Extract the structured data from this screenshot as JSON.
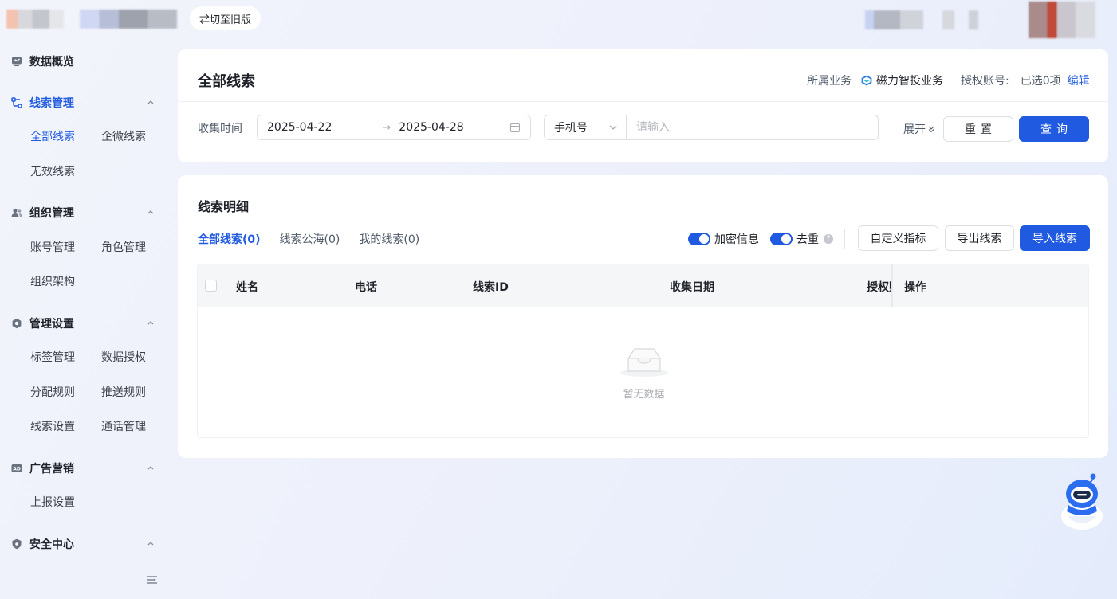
{
  "topbar": {
    "switch_old_label": "⇄切至旧版"
  },
  "sidebar": {
    "groups": [
      {
        "label": "数据概览",
        "icon": "dashboard-icon",
        "items": []
      },
      {
        "label": "线索管理",
        "icon": "flow-icon",
        "active": true,
        "items": [
          {
            "label": "全部线索",
            "active": true
          },
          {
            "label": "企微线索"
          },
          {
            "label": "无效线索"
          }
        ]
      },
      {
        "label": "组织管理",
        "icon": "users-icon",
        "items": [
          {
            "label": "账号管理"
          },
          {
            "label": "角色管理"
          },
          {
            "label": "组织架构"
          }
        ]
      },
      {
        "label": "管理设置",
        "icon": "settings-icon",
        "items": [
          {
            "label": "标签管理"
          },
          {
            "label": "数据授权"
          },
          {
            "label": "分配规则"
          },
          {
            "label": "推送规则"
          },
          {
            "label": "线索设置"
          },
          {
            "label": "通话管理"
          }
        ]
      },
      {
        "label": "广告营销",
        "icon": "ad-icon",
        "items": [
          {
            "label": "上报设置"
          }
        ]
      },
      {
        "label": "安全中心",
        "icon": "shield-icon",
        "items": []
      }
    ]
  },
  "filter": {
    "title": "全部线索",
    "biz_label": "所属业务",
    "biz_name": "磁力智投业务",
    "auth_label": "授权账号:",
    "auth_value": "已选0项",
    "edit_label": "编辑",
    "collect_time_label": "收集时间",
    "date_start": "2025-04-22",
    "date_sep": "→",
    "date_end": "2025-04-28",
    "phone_select": "手机号",
    "phone_placeholder": "请输入",
    "expand_label": "展开",
    "reset_label": "重置",
    "query_label": "查询"
  },
  "detail": {
    "title": "线索明细",
    "tabs": [
      "全部线索(0)",
      "线索公海(0)",
      "我的线索(0)"
    ],
    "toggle_encrypt_label": "加密信息",
    "toggle_dedupe_label": "去重",
    "custom_metric_label": "自定义指标",
    "export_label": "导出线索",
    "import_label": "导入线索",
    "columns": [
      "姓名",
      "电话",
      "线索ID",
      "收集日期",
      "授权账号",
      "操作"
    ],
    "empty_text": "暂无数据"
  },
  "colors": {
    "primary": "#1f5ae0",
    "text": "#1f2329",
    "muted": "#4e5969"
  }
}
